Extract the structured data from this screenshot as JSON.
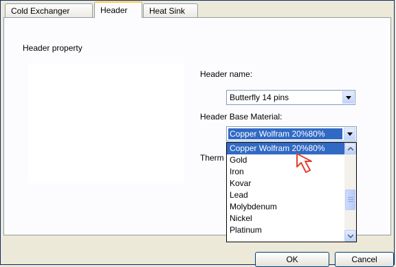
{
  "tabs": [
    {
      "label": "Cold Exchanger",
      "active": false
    },
    {
      "label": "Header",
      "active": true
    },
    {
      "label": "Heat Sink",
      "active": false
    }
  ],
  "group_label": "Header property",
  "header_name": {
    "label": "Header name:",
    "value": "Butterfly 14 pins"
  },
  "base_material": {
    "label": "Header Base Material:",
    "value": "Copper Wolfram 20%80%",
    "options": [
      "Copper Wolfram 20%80%",
      "Gold",
      "Iron",
      "Kovar",
      "Lead",
      "Molybdenum",
      "Nickel",
      "Platinum"
    ],
    "selected_index": 0
  },
  "obscured_label": "Therm",
  "buttons": {
    "ok": "OK",
    "cancel": "Cancel"
  },
  "colors": {
    "selection": "#316ac5",
    "tab_highlight": "#ffc83c",
    "pointer_arrow": "#e0412c"
  },
  "icons": {
    "combo_arrow": "chevron-down-icon",
    "pointer": "arrow-pointer-icon"
  }
}
